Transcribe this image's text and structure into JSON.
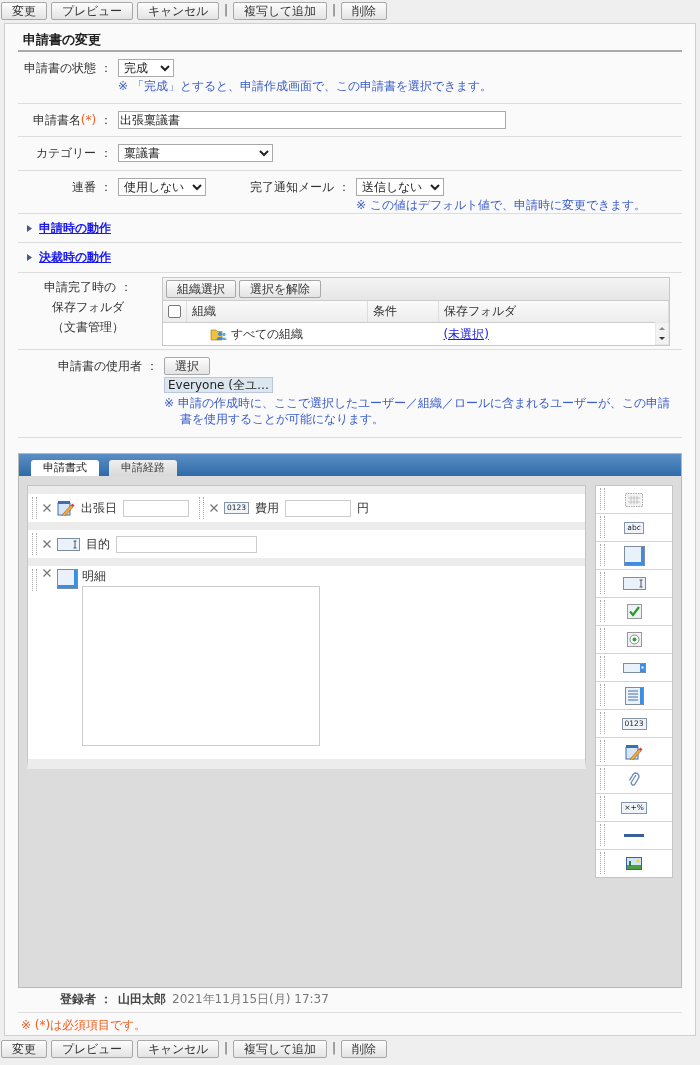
{
  "toolbar_top": [
    {
      "kind": "button",
      "label": "変更"
    },
    {
      "kind": "button",
      "label": "プレビュー"
    },
    {
      "kind": "button",
      "label": "キャンセル"
    },
    {
      "kind": "separator",
      "label": "|"
    },
    {
      "kind": "button",
      "label": "複写して追加"
    },
    {
      "kind": "separator",
      "label": "|"
    },
    {
      "kind": "button",
      "label": "削除"
    }
  ],
  "title": "申請書の変更",
  "status": {
    "label": "申請書の状態 ：",
    "value": "完成",
    "note": "※ 「完成」とすると、申請作成画面で、この申請書を選択できます。"
  },
  "name": {
    "label": "申請書名",
    "required_mark": "(*)",
    "colon": " ：",
    "value": "出張稟議書"
  },
  "category": {
    "label": "カテゴリー ：",
    "value": "稟議書"
  },
  "serial": {
    "label": "連番 ：",
    "value": "使用しない"
  },
  "notify_mail": {
    "label": "完了通知メール ：",
    "value": "送信しない",
    "note": "※ この値はデフォルト値で、申請時に変更できます。"
  },
  "sections": [
    {
      "label": "申請時の動作",
      "expanded": false
    },
    {
      "label": "決裁時の動作",
      "expanded": false
    }
  ],
  "save_folder": {
    "label_lines": [
      "申請完了時の ：",
      "保存フォルダ",
      "（文書管理）"
    ],
    "buttons": [
      "組織選択",
      "選択を解除"
    ],
    "checked": false,
    "columns": [
      "組織",
      "条件",
      "保存フォルダ"
    ],
    "rows": [
      {
        "organization": "すべての組織",
        "folder": "(未選択)"
      }
    ]
  },
  "users": {
    "label": "申請書の使用者 ：",
    "button": "選択",
    "chip": "Everyone (全ユ…",
    "note": "※ 申請の作成時に、ここで選択したユーザー／組織／ロールに含まれるユーザーが、この申請書を使用することが可能になります。"
  },
  "designer": {
    "tabs": [
      {
        "label": "申請書式",
        "selected": true
      },
      {
        "label": "申請経路",
        "selected": false
      }
    ],
    "rows": [
      [
        {
          "kind": "date",
          "label": "出張日"
        },
        {
          "kind": "number",
          "icon_text": "0123",
          "label": "費用",
          "unit": "円"
        }
      ],
      [
        {
          "kind": "input",
          "label": "目的"
        }
      ],
      [
        {
          "kind": "textarea",
          "label": "明細"
        }
      ]
    ],
    "palette": [
      {
        "kind": "label"
      },
      {
        "kind": "text",
        "text": "abc"
      },
      {
        "kind": "textarea"
      },
      {
        "kind": "input"
      },
      {
        "kind": "checkbox"
      },
      {
        "kind": "radio"
      },
      {
        "kind": "select"
      },
      {
        "kind": "listbox"
      },
      {
        "kind": "number",
        "text": "0123"
      },
      {
        "kind": "date"
      },
      {
        "kind": "attachment"
      },
      {
        "kind": "calc",
        "text": "×+%"
      },
      {
        "kind": "line"
      },
      {
        "kind": "image"
      }
    ]
  },
  "registrant": {
    "label": "登録者 ：",
    "name": "山田太郎",
    "date": "2021年11月15日(月) 17:37"
  },
  "required_note": "※ (*)は必須項目です。",
  "toolbar_bottom": [
    {
      "kind": "button",
      "label": "変更"
    },
    {
      "kind": "button",
      "label": "プレビュー"
    },
    {
      "kind": "button",
      "label": "キャンセル"
    },
    {
      "kind": "separator",
      "label": "|"
    },
    {
      "kind": "button",
      "label": "複写して追加"
    },
    {
      "kind": "separator",
      "label": "|"
    },
    {
      "kind": "button",
      "label": "削除"
    }
  ]
}
